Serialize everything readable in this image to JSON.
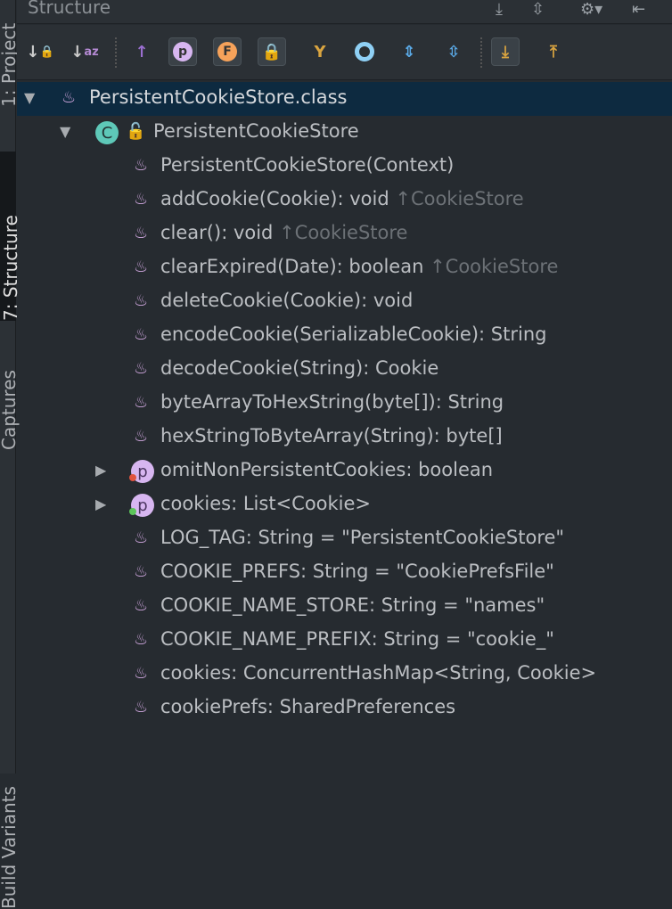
{
  "side_tabs": [
    "1: Project",
    "7: Structure",
    "Captures",
    "Build Variants"
  ],
  "panel": {
    "title": "Structure"
  },
  "toolbar": {
    "buttons": [
      "sort-by-visibility",
      "sort-alphabetically",
      "show-inherited",
      "show-properties",
      "show-fields",
      "show-non-public",
      "show-anonymous",
      "show-lambdas",
      "expand-all",
      "collapse-all",
      "autoscroll-to-source",
      "autoscroll-from-source"
    ]
  },
  "tree": {
    "root": "PersistentCookieStore.class",
    "class": "PersistentCookieStore",
    "members": [
      {
        "text": "PersistentCookieStore(Context)",
        "inherit": ""
      },
      {
        "text": "addCookie(Cookie): void",
        "inherit": "↑CookieStore"
      },
      {
        "text": "clear(): void",
        "inherit": "↑CookieStore"
      },
      {
        "text": "clearExpired(Date): boolean",
        "inherit": "↑CookieStore"
      },
      {
        "text": "deleteCookie(Cookie): void",
        "inherit": ""
      },
      {
        "text": "encodeCookie(SerializableCookie): String",
        "inherit": ""
      },
      {
        "text": "decodeCookie(String): Cookie",
        "inherit": ""
      },
      {
        "text": "byteArrayToHexString(byte[]): String",
        "inherit": ""
      },
      {
        "text": "hexStringToByteArray(String): byte[]",
        "inherit": ""
      },
      {
        "text": "omitNonPersistentCookies: boolean",
        "inherit": "",
        "property": true,
        "dot": "#e0533f"
      },
      {
        "text": "cookies: List<Cookie>",
        "inherit": "",
        "property": true,
        "dot": "#5cc45a"
      },
      {
        "text": "LOG_TAG: String = \"PersistentCookieStore\"",
        "inherit": ""
      },
      {
        "text": "COOKIE_PREFS: String = \"CookiePrefsFile\"",
        "inherit": ""
      },
      {
        "text": "COOKIE_NAME_STORE: String = \"names\"",
        "inherit": ""
      },
      {
        "text": "COOKIE_NAME_PREFIX: String = \"cookie_\"",
        "inherit": ""
      },
      {
        "text": "cookies: ConcurrentHashMap<String, Cookie>",
        "inherit": ""
      },
      {
        "text": "cookiePrefs: SharedPreferences",
        "inherit": ""
      }
    ]
  }
}
